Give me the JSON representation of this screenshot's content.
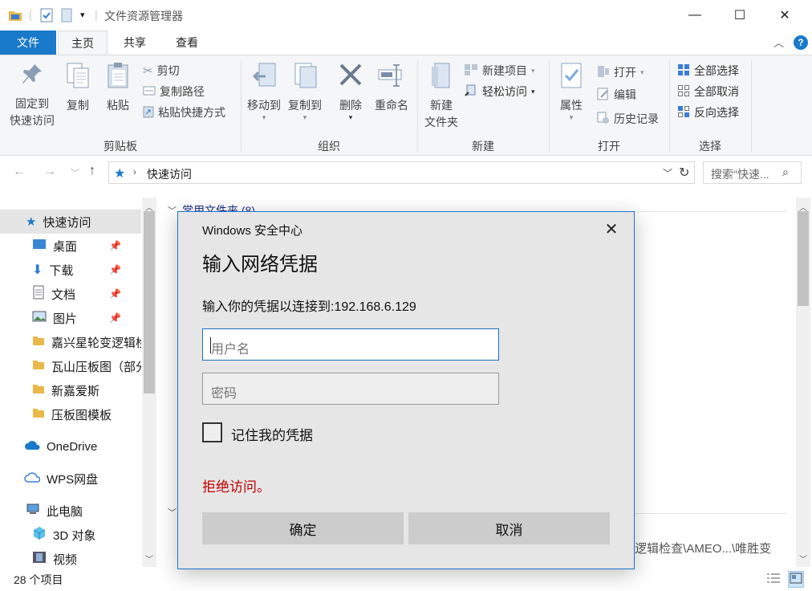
{
  "window": {
    "title": "文件资源管理器",
    "minimize": "—",
    "maximize": "☐",
    "close": "✕"
  },
  "ribbon_tabs": {
    "file": "文件",
    "home": "主页",
    "share": "共享",
    "view": "查看"
  },
  "ribbon": {
    "clipboard": {
      "pin_line1": "固定到",
      "pin_line2": "快速访问",
      "copy": "复制",
      "paste": "粘贴",
      "cut": "剪切",
      "copy_path": "复制路径",
      "paste_shortcut": "粘贴快捷方式",
      "label": "剪贴板"
    },
    "organize": {
      "move_to": "移动到",
      "copy_to": "复制到",
      "delete": "删除",
      "rename": "重命名",
      "label": "组织"
    },
    "new": {
      "new_item": "新建项目",
      "easy_access": "轻松访问",
      "new_folder_line1": "新建",
      "new_folder_line2": "文件夹",
      "label": "新建"
    },
    "open": {
      "properties": "属性",
      "open": "打开",
      "edit": "编辑",
      "history": "历史记录",
      "label": "打开"
    },
    "select": {
      "select_all": "全部选择",
      "select_none": "全部取消",
      "invert": "反向选择",
      "label": "选择"
    }
  },
  "address": {
    "path": "快速访问",
    "search_placeholder": "搜索\"快速..."
  },
  "nav": {
    "quick_access": "快速访问",
    "items": [
      {
        "label": "桌面"
      },
      {
        "label": "下载"
      },
      {
        "label": "文档"
      },
      {
        "label": "图片"
      },
      {
        "label": "嘉兴星轮变逻辑检"
      },
      {
        "label": "瓦山压板图（部分"
      },
      {
        "label": "新嘉爱斯"
      },
      {
        "label": "压板图模板"
      }
    ],
    "onedrive": "OneDrive",
    "wps": "WPS网盘",
    "this_pc": "此电脑",
    "objects3d": "3D 对象",
    "videos": "视频"
  },
  "content": {
    "frequent_header": "常用文件夹 (8)",
    "recent_path": "\\逻辑检查\\AMEO...\\唯胜变"
  },
  "status": {
    "item_count": "28 个项目"
  },
  "dialog": {
    "caption": "Windows 安全中心",
    "title": "输入网络凭据",
    "message": "输入你的凭据以连接到:192.168.6.129",
    "username_placeholder": "用户名",
    "password_placeholder": "密码",
    "remember_label": "记住我的凭据",
    "error": "拒绝访问。",
    "ok": "确定",
    "cancel": "取消"
  },
  "colors": {
    "accent": "#1979ca",
    "error": "#c00000",
    "folder": "#e8b84a"
  }
}
